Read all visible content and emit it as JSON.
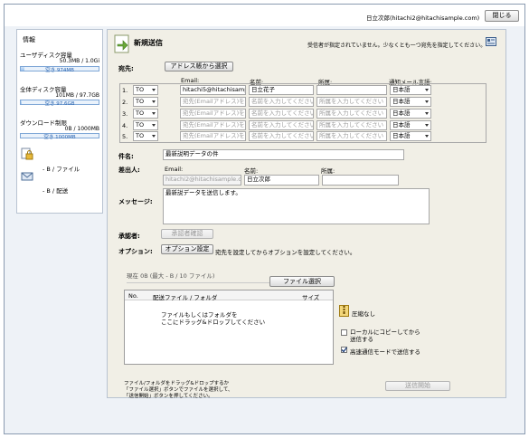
{
  "header": {
    "user": "日立次郎(hitachi2@hitachisample.com)",
    "close_label": "閉じる"
  },
  "sidebar": {
    "title": "情報",
    "user_disk": {
      "label": "ユーザディスク容量",
      "usage": "50.3MB / 1.0Gi",
      "free": "空き 974MB",
      "fill": 0.05
    },
    "total_disk": {
      "label": "全体ディスク容量",
      "usage": "101MB / 97.7GB",
      "free": "空き 97.6GB",
      "fill": 0.01
    },
    "download": {
      "label": "ダウンロード制限",
      "usage": "0B / 1000MB",
      "free": "空き 1000MB",
      "fill": 0.0
    },
    "per_file": "- B / ファイル",
    "per_delivery": "- B / 配送"
  },
  "main": {
    "title": "新規送信",
    "warning": "受信者が指定されていません。少なくとも一つ宛先を指定してください。",
    "recipients_label": "宛先:",
    "address_book_button": "アドレス帳から選択",
    "columns": {
      "email": "Email:",
      "name": "名前:",
      "org": "所属:",
      "lang": "通知メール言語:"
    },
    "rows": [
      {
        "no": "1.",
        "type": "TO",
        "email": "hitachi5@hitachisample",
        "name": "日立花子",
        "org": "",
        "lang": "日本語"
      },
      {
        "no": "2.",
        "type": "TO",
        "email": "宛先(Emailアドレス)を入",
        "name": "名前を入力してください",
        "org": "所属を入力してください",
        "lang": "日本語"
      },
      {
        "no": "3.",
        "type": "TO",
        "email": "宛先(Emailアドレス)を入",
        "name": "名前を入力してください",
        "org": "所属を入力してください",
        "lang": "日本語"
      },
      {
        "no": "4.",
        "type": "TO",
        "email": "宛先(Emailアドレス)を入",
        "name": "名前を入力してください",
        "org": "所属を入力してください",
        "lang": "日本語"
      },
      {
        "no": "5.",
        "type": "TO",
        "email": "宛先(Emailアドレス)を入",
        "name": "名前を入力してください",
        "org": "所属を入力してください",
        "lang": "日本語"
      }
    ],
    "subject": {
      "label": "件名:",
      "value": "最新説明データの件"
    },
    "sender": {
      "label": "差出人:",
      "email_label": "Email:",
      "name_label": "名前:",
      "org_label": "所属:",
      "email": "hitachi2@hitachisample.com",
      "name": "日立次郎",
      "org": ""
    },
    "message": {
      "label": "メッセージ:",
      "value": "最新説データを送信します。"
    },
    "approver": {
      "label": "承認者:",
      "button": "承認者確認"
    },
    "options": {
      "label": "オプション:",
      "button": "オプション設定",
      "hint": "宛先を設定してからオプションを設定してください。"
    },
    "files": {
      "status": "現在 0B (最大 - B / 10 ファイル)",
      "select_button": "ファイル選択",
      "col_no": "No.",
      "col_name": "配送ファイル / フォルダ",
      "col_size": "サイズ",
      "drop_hint_1": "ファイルもしくはフォルダを",
      "drop_hint_2": "ここにドラッグ&ドロップしてください"
    },
    "compress": "圧縮なし",
    "local_copy_1": "ローカルにコピーしてから",
    "local_copy_2": "送信する",
    "local_copy_checked": false,
    "fast_mode": "高速通信モードで送信する",
    "fast_mode_checked": true,
    "footer_hint_1": "ファイル/フォルダをドラッグ&ドロップするか",
    "footer_hint_2": "「ファイル選択」ボタンでファイルを選択して、",
    "footer_hint_3": "「送信開始」ボタンを押してください。",
    "send_button": "送信開始"
  }
}
